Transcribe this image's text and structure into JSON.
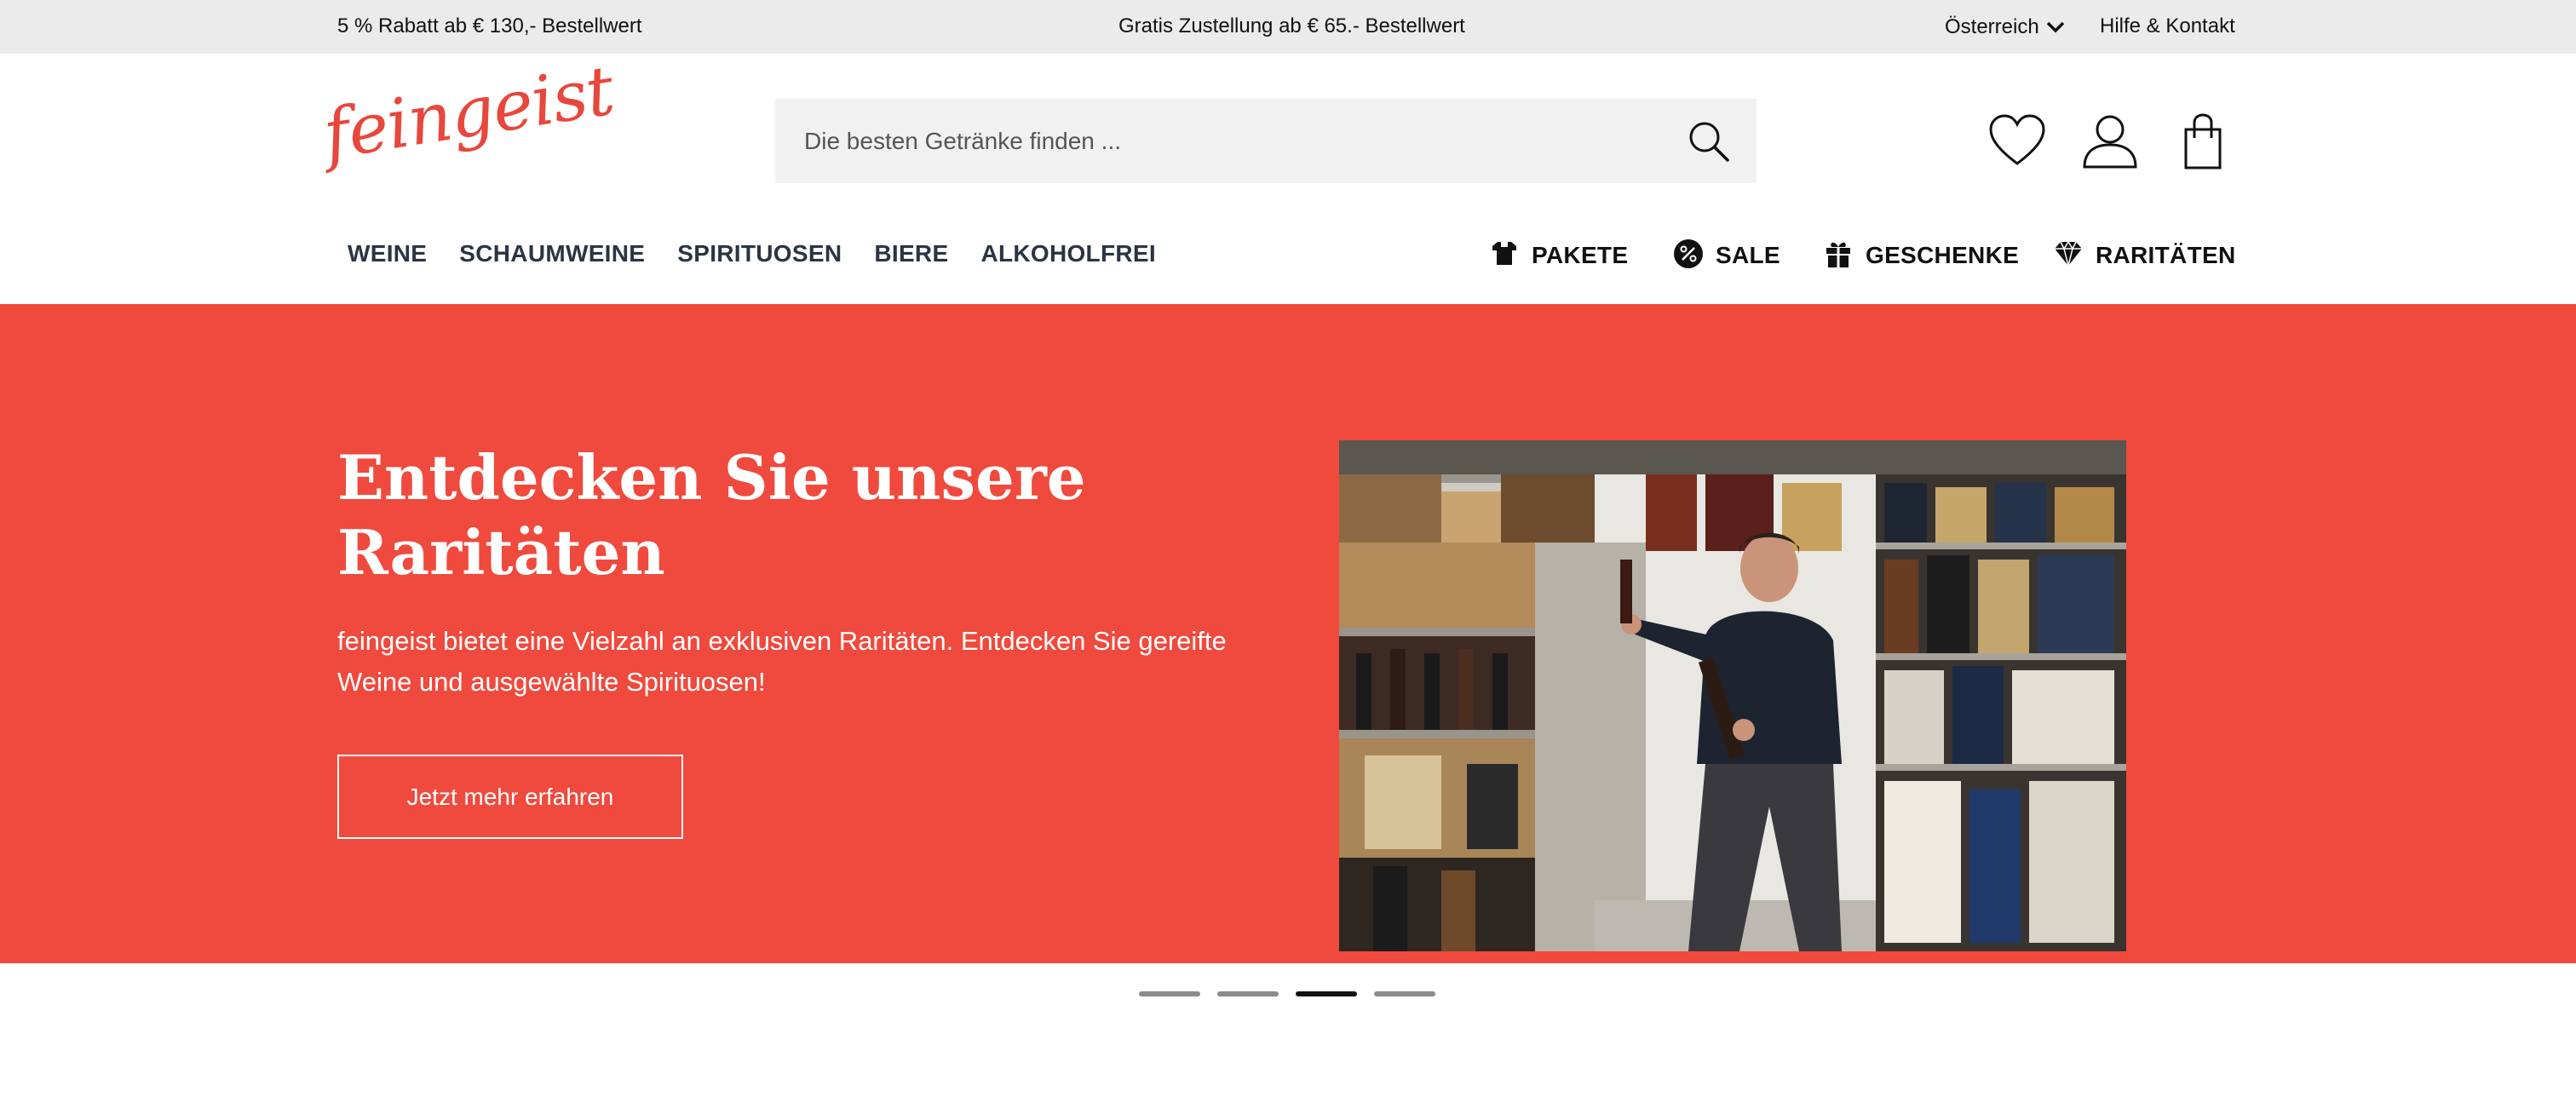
{
  "topbar": {
    "promo_discount": "5 % Rabatt ab € 130,- Bestellwert",
    "promo_shipping": "Gratis Zustellung ab € 65.- Bestellwert",
    "country": "Österreich",
    "help": "Hilfe & Kontakt"
  },
  "header": {
    "logo": "feingeist",
    "search_placeholder": "Die besten Getränke finden ...",
    "icons": [
      "heart-icon",
      "user-icon",
      "shopping-bag-icon"
    ]
  },
  "nav": {
    "main": [
      "WEINE",
      "SCHAUMWEINE",
      "SPIRITUOSEN",
      "BIERE",
      "ALKOHOLFREI"
    ],
    "special": [
      {
        "label": "PAKETE",
        "icon": "package-icon"
      },
      {
        "label": "SALE",
        "icon": "percent-icon"
      },
      {
        "label": "GESCHENKE",
        "icon": "gift-icon"
      },
      {
        "label": "RARITÄTEN",
        "icon": "diamond-icon"
      }
    ]
  },
  "hero": {
    "title": "Entdecken Sie unsere Raritäten",
    "description": "feingeist bietet eine Vielzahl an exklusiven Raritäten. Entdecken Sie gereifte Weine und ausgewählte Spirituosen!",
    "cta": "Jetzt mehr erfahren",
    "background_color": "#ef4a3d"
  },
  "slider": {
    "count": 4,
    "active_index": 3
  },
  "colors": {
    "brand": "#e8473c",
    "topbar": "#ebebeb",
    "search_bg": "#f1f1f1"
  }
}
